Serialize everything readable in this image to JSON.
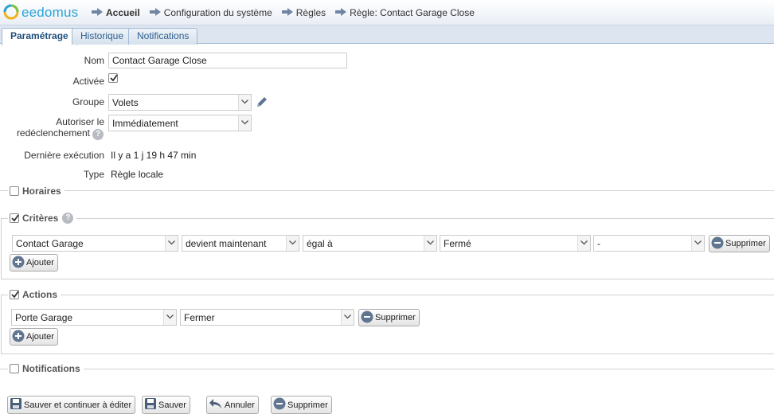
{
  "app": {
    "logo_text": "eedomus"
  },
  "breadcrumb": [
    "Accueil",
    "Configuration du système",
    "Règles",
    "Règle: Contact Garage Close"
  ],
  "tabs": [
    {
      "label": "Paramétrage",
      "active": true
    },
    {
      "label": "Historique",
      "active": false
    },
    {
      "label": "Notifications",
      "active": false
    }
  ],
  "form": {
    "nom_label": "Nom",
    "nom_value": "Contact Garage Close",
    "activee_label": "Activée",
    "activee_checked": true,
    "groupe_label": "Groupe",
    "groupe_value": "Volets",
    "redecl_label_1": "Autoriser le",
    "redecl_label_2": "redéclenchement",
    "redecl_value": "Immédiatement",
    "derniere_label": "Dernière exécution",
    "derniere_value": "Il y a 1 j 19 h 47 min",
    "type_label": "Type",
    "type_value": "Règle locale",
    "help_glyph": "?"
  },
  "sections": {
    "horaires": {
      "label": "Horaires",
      "checked": false
    },
    "criteres": {
      "label": "Critères",
      "checked": true
    },
    "actions": {
      "label": "Actions",
      "checked": true
    },
    "notifications": {
      "label": "Notifications",
      "checked": false
    }
  },
  "criteria_row": {
    "device": "Contact Garage",
    "condition": "devient maintenant",
    "operator": "égal à",
    "value": "Fermé",
    "extra": "-",
    "delete_label": "Supprimer"
  },
  "action_row": {
    "device": "Porte Garage",
    "command": "Fermer",
    "delete_label": "Supprimer"
  },
  "buttons": {
    "add": "Ajouter",
    "save_continue": "Sauver et continuer à éditer",
    "save": "Sauver",
    "cancel": "Annuler",
    "delete": "Supprimer"
  },
  "colors": {
    "accent": "#2aa3d8",
    "tab_text": "#2f5f8f",
    "tab_border": "#9fb8d3"
  }
}
